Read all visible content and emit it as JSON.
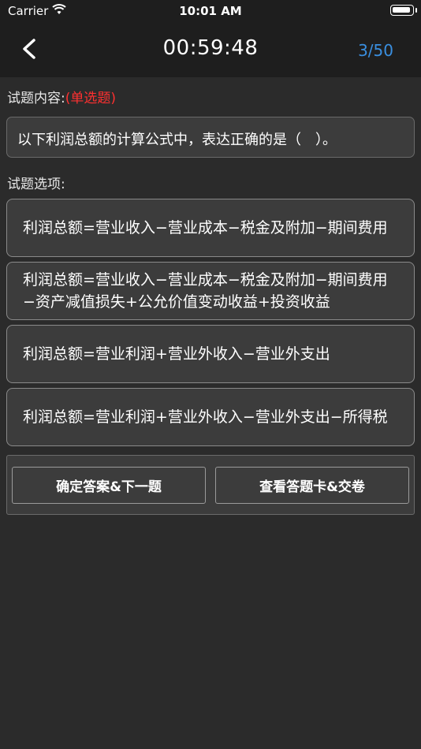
{
  "status_bar": {
    "carrier": "Carrier",
    "time": "10:01 AM"
  },
  "nav": {
    "timer": "00:59:48",
    "progress": "3/50"
  },
  "question": {
    "content_label": "试题内容:",
    "type_label": "(单选题)",
    "text": "以下利润总额的计算公式中，表达正确的是（　）。"
  },
  "options_label": "试题选项:",
  "options": [
    "利润总额=营业收入−营业成本−税金及附加−期间费用",
    "利润总额=营业收入−营业成本−税金及附加−期间费用−资产减值损失+公允价值变动收益+投资收益",
    "利润总额=营业利润+营业外收入−营业外支出",
    "利润总额=营业利润+营业外收入−营业外支出−所得税"
  ],
  "buttons": {
    "confirm": "确定答案&下一题",
    "answer_card": "查看答题卡&交卷"
  }
}
